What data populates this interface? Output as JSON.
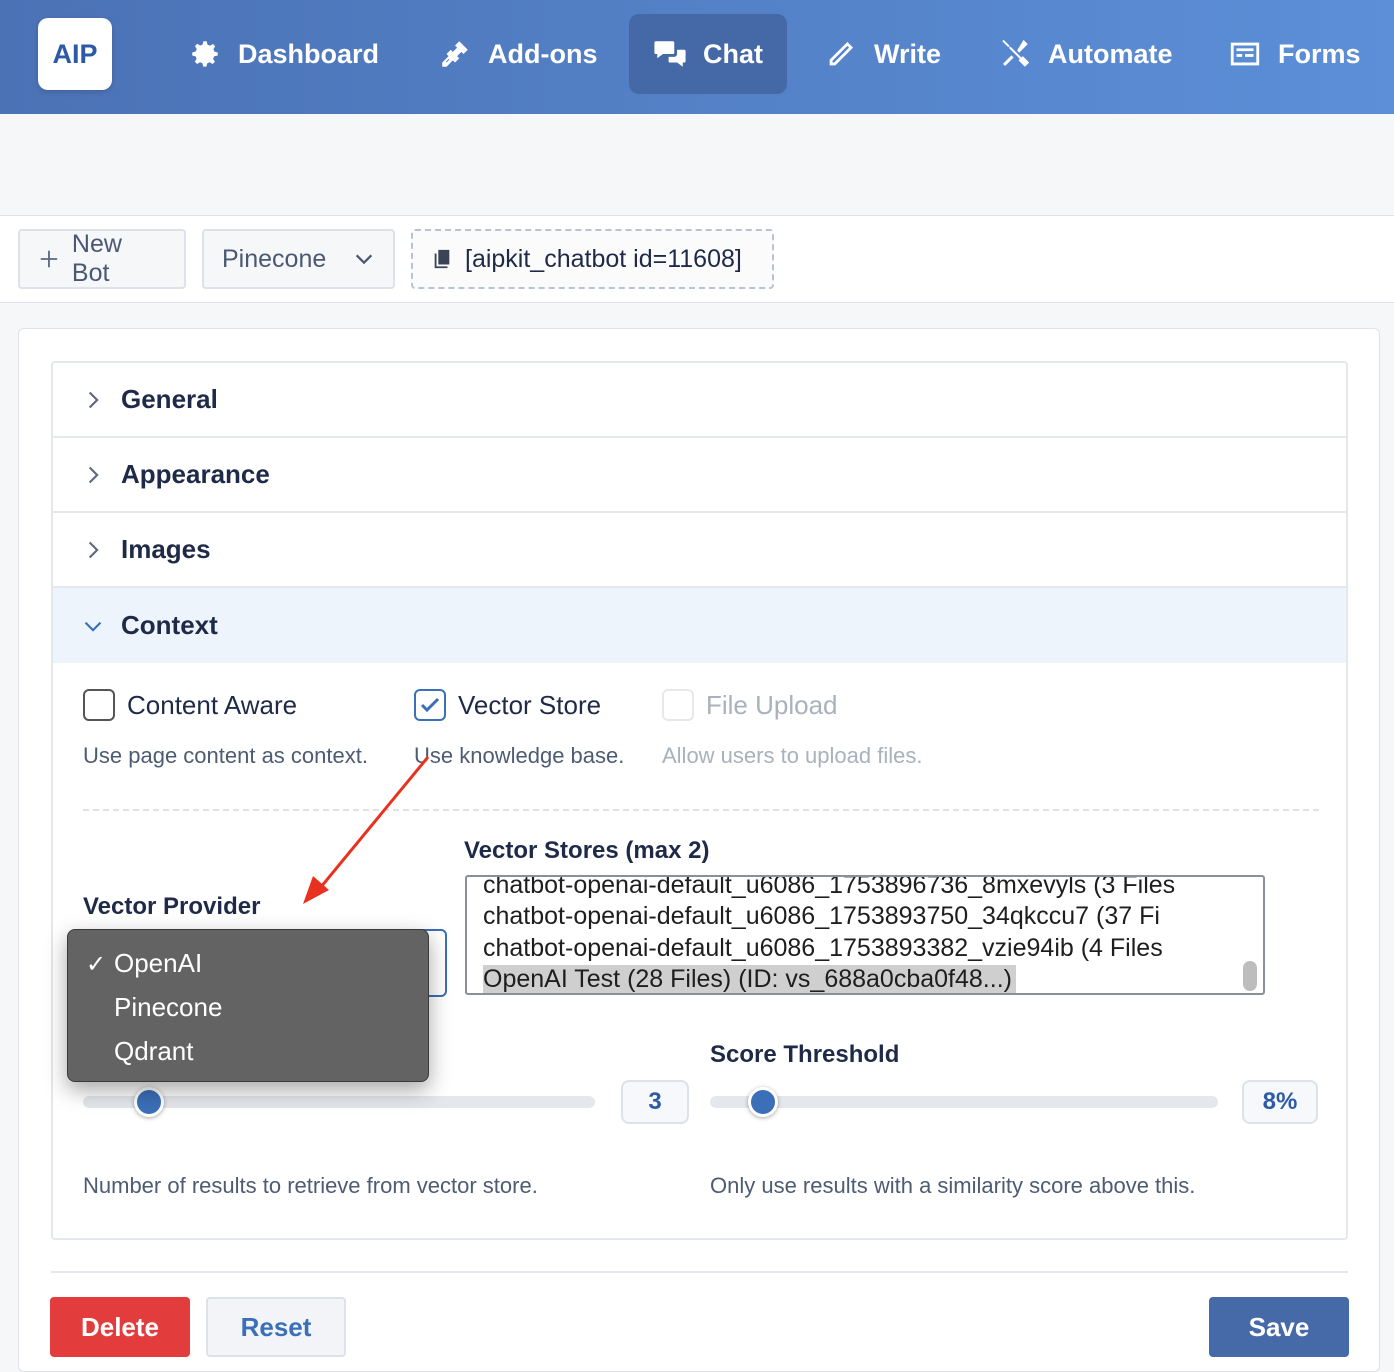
{
  "app": {
    "logo": "AIP"
  },
  "nav": [
    {
      "label": "Dashboard",
      "icon": "gear-icon"
    },
    {
      "label": "Add-ons",
      "icon": "plug-icon"
    },
    {
      "label": "Chat",
      "icon": "chat-bubbles-icon",
      "active": true
    },
    {
      "label": "Write",
      "icon": "pencil-icon"
    },
    {
      "label": "Automate",
      "icon": "tools-icon"
    },
    {
      "label": "Forms",
      "icon": "form-icon"
    }
  ],
  "toolbar": {
    "new_bot": "New Bot",
    "bot_select": "Pinecone",
    "shortcode": "[aipkit_chatbot id=11608]"
  },
  "sections": {
    "general": "General",
    "appearance": "Appearance",
    "images": "Images",
    "context": "Context"
  },
  "context": {
    "content_aware": {
      "label": "Content Aware",
      "help": "Use page content as context.",
      "checked": false
    },
    "vector_store": {
      "label": "Vector Store",
      "help": "Use knowledge base.",
      "checked": true
    },
    "file_upload": {
      "label": "File Upload",
      "help": "Allow users to upload files.",
      "disabled": true
    },
    "vector_provider_label": "Vector Provider",
    "vector_stores_label": "Vector Stores (max 2)",
    "vector_stores": [
      "chatbot-openai-default_u6086_1753896736_8mxevyls (3 Files",
      "chatbot-openai-default_u6086_1753893750_34qkccu7 (37 Fi",
      "chatbot-openai-default_u6086_1753893382_vzie94ib (4 Files",
      "OpenAI Test (28 Files) (ID: vs_688a0cba0f48...)"
    ],
    "selected_store_index": 3,
    "provider_options": [
      "OpenAI",
      "Pinecone",
      "Qdrant"
    ],
    "selected_provider": "OpenAI",
    "check_mark": "✓",
    "results_count": "3",
    "results_help": "Number of results to retrieve from vector store.",
    "score_threshold_label": "Score Threshold",
    "score_threshold": "8%",
    "score_help": "Only use results with a similarity score above this."
  },
  "actions": {
    "delete": "Delete",
    "reset": "Reset",
    "save": "Save"
  },
  "colors": {
    "accent": "#3b6fb8",
    "danger": "#e23c3c",
    "annotation_arrow": "#e8321f"
  }
}
